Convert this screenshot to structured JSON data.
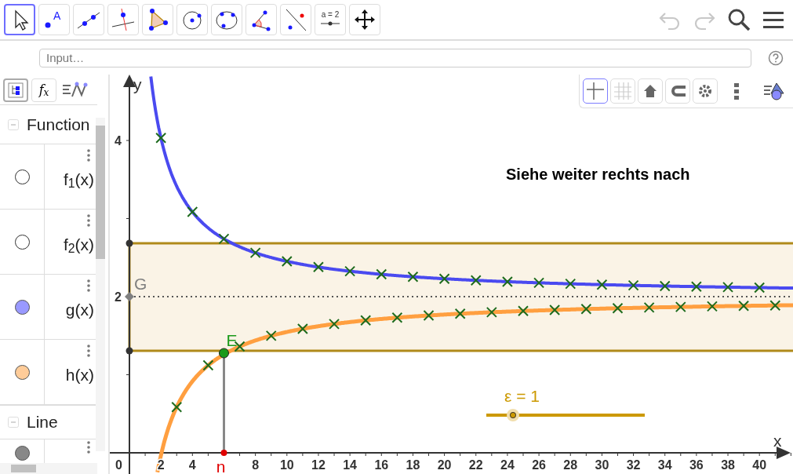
{
  "toolbar": {
    "tools": [
      {
        "kind": "move",
        "selected": true
      },
      {
        "kind": "point",
        "label": "A",
        "selected": false
      },
      {
        "kind": "line",
        "selected": false
      },
      {
        "kind": "perpendicular",
        "selected": false
      },
      {
        "kind": "polygon",
        "selected": false
      },
      {
        "kind": "circle",
        "selected": false
      },
      {
        "kind": "conic",
        "selected": false
      },
      {
        "kind": "angle",
        "selected": false
      },
      {
        "kind": "reflect",
        "selected": false
      },
      {
        "kind": "slider",
        "label": "a = 2",
        "selected": false
      },
      {
        "kind": "move-view",
        "selected": false
      }
    ],
    "actions": [
      {
        "kind": "undo",
        "disabled": true
      },
      {
        "kind": "redo",
        "disabled": true
      },
      {
        "kind": "search",
        "disabled": false
      },
      {
        "kind": "menu",
        "disabled": false
      }
    ]
  },
  "input_bar": {
    "placeholder": "Input…"
  },
  "algebra": {
    "tabs": [
      {
        "kind": "tree",
        "selected": true
      },
      {
        "kind": "formula",
        "label": "f$_{x}$",
        "selected": false
      },
      {
        "kind": "tools",
        "selected": false
      }
    ],
    "groups": [
      {
        "title": "Function",
        "items": [
          {
            "label": "f$_{1}$(x)",
            "visible": false
          },
          {
            "label": "f$_{2}$(x)",
            "visible": false
          },
          {
            "label": "g(x)",
            "visible": true,
            "color": "#9999ff"
          },
          {
            "label": "h(x)",
            "visible": true,
            "color": "#ffcc99"
          }
        ]
      },
      {
        "title": "Line",
        "items": [
          {
            "visible": true,
            "color": "#888888"
          }
        ]
      }
    ]
  },
  "graphics": {
    "style_bar": [
      {
        "kind": "axes",
        "selected": true
      },
      {
        "kind": "grid",
        "selected": false
      },
      {
        "kind": "home",
        "selected": false
      },
      {
        "kind": "magnet",
        "selected": false
      },
      {
        "kind": "settings",
        "selected": false
      },
      {
        "kind": "more",
        "selected": false
      },
      {
        "kind": "view",
        "selected": false
      }
    ],
    "x_axis": {
      "label": "x",
      "origin": "0",
      "ticks": [
        "2",
        "4",
        "8",
        "10",
        "12",
        "14",
        "16",
        "18",
        "20",
        "22",
        "24",
        "26",
        "28",
        "30",
        "32",
        "34",
        "36",
        "38",
        "40"
      ]
    },
    "y_axis": {
      "label": "y",
      "ticks": [
        "4",
        "2"
      ]
    },
    "points": [
      {
        "kind": "limit",
        "label": "G"
      },
      {
        "kind": "curve",
        "label": "E"
      },
      {
        "kind": "axis",
        "label": "n"
      }
    ],
    "note": "Siehe weiter rechts nach",
    "slider": {
      "label": "ε = 1",
      "level": 0.17
    }
  }
}
